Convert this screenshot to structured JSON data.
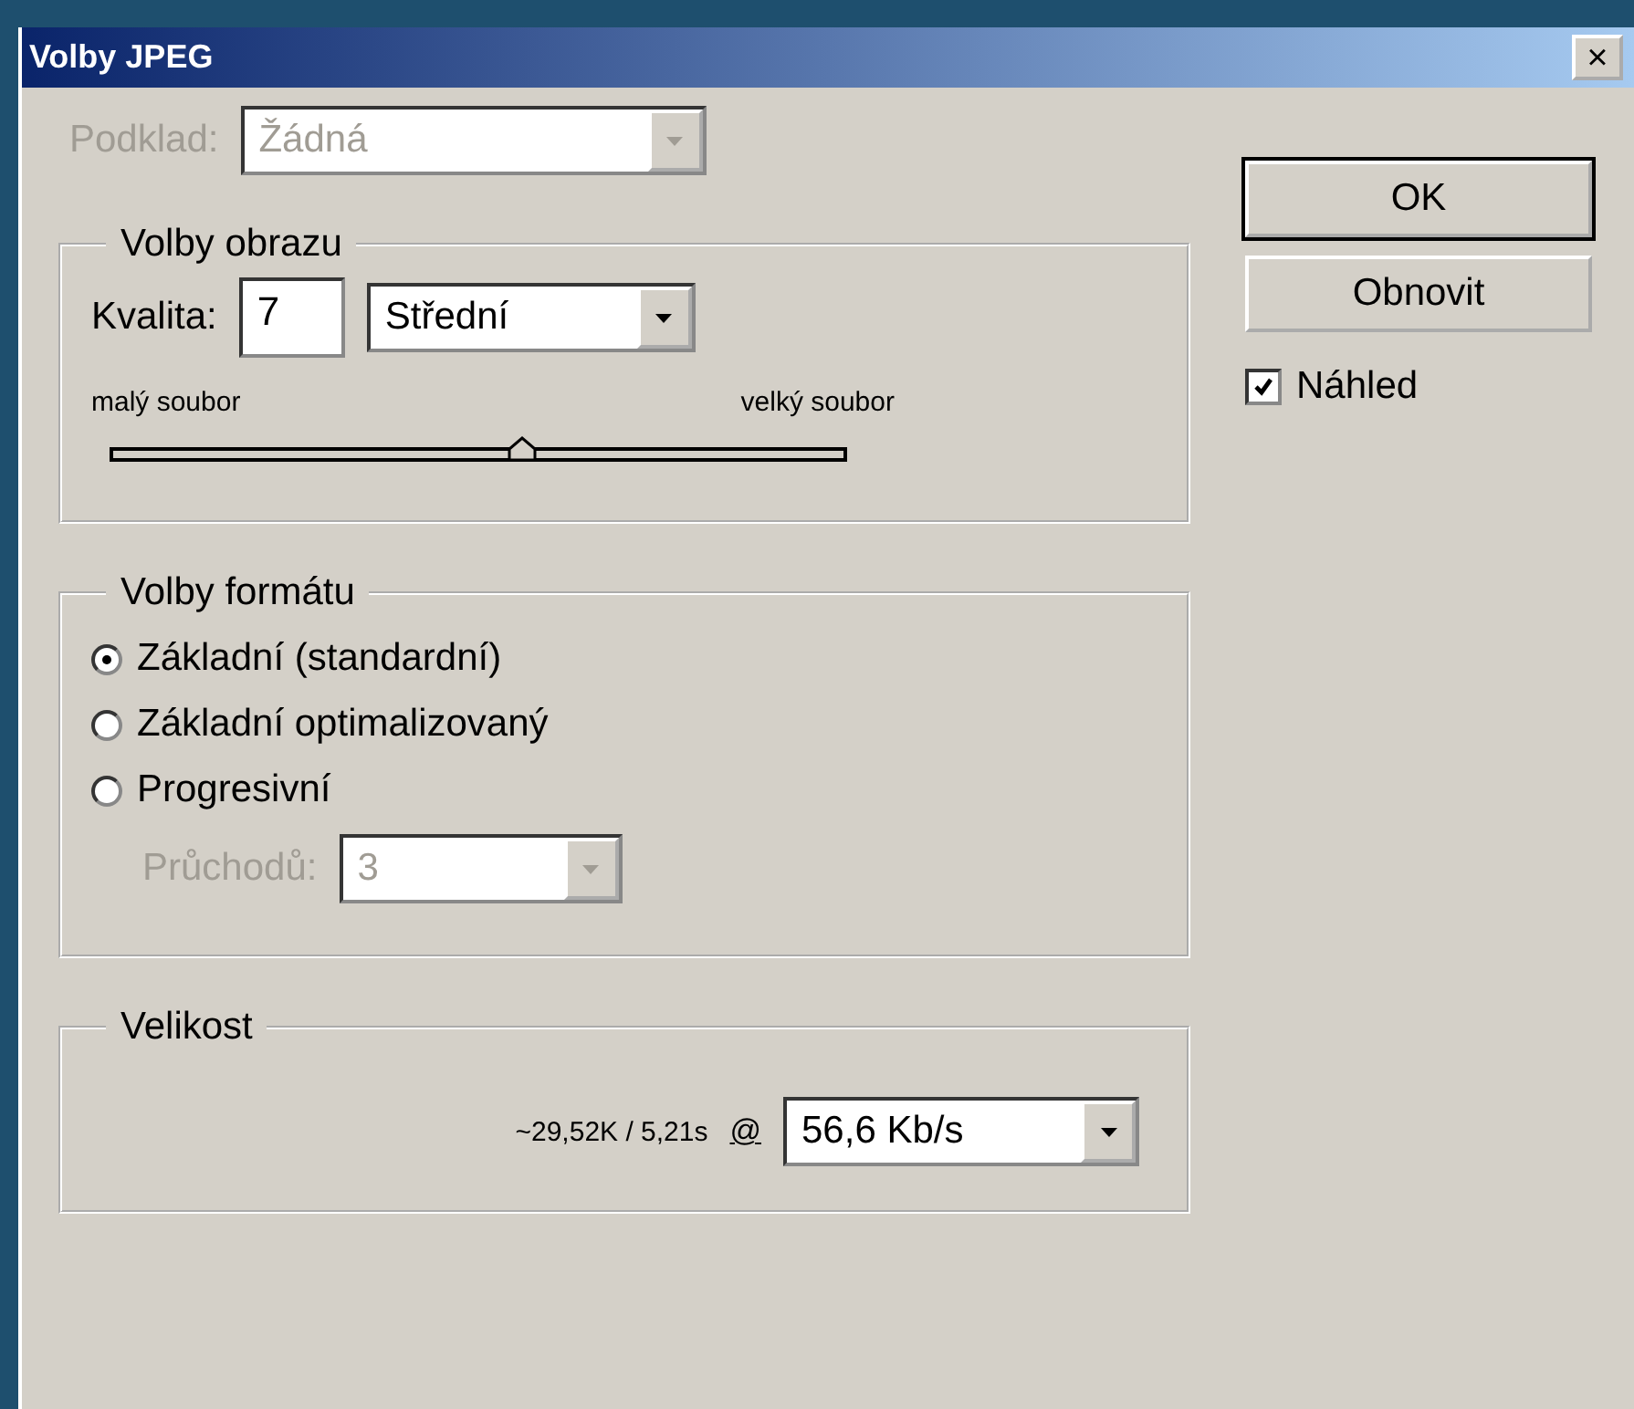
{
  "window": {
    "title": "Volby JPEG",
    "close": "×"
  },
  "matte": {
    "label": "Podklad:",
    "value": "Žádná",
    "disabled": true
  },
  "image_options": {
    "title": "Volby obrazu",
    "quality_label": "Kvalita:",
    "quality_value": "7",
    "quality_preset": "Střední",
    "min_label": "malý soubor",
    "max_label": "velký soubor",
    "level": 0.56
  },
  "format_options": {
    "title": "Volby formátu",
    "options": [
      {
        "label": "Základní (standardní)",
        "selected": true
      },
      {
        "label": "Základní optimalizovaný",
        "selected": false
      },
      {
        "label": "Progresivní",
        "selected": false
      }
    ],
    "scans": {
      "label": "Průchodů:",
      "value": "3",
      "disabled": true
    }
  },
  "size": {
    "title": "Velikost",
    "estimate": "~29,52K / 5,21s",
    "at": "@",
    "speed": "56,6 Kb/s"
  },
  "buttons": [
    {
      "label": "OK",
      "default": true
    },
    {
      "label": "Obnovit",
      "default": false
    }
  ],
  "preview": {
    "label": "Náhled",
    "checked": true
  }
}
